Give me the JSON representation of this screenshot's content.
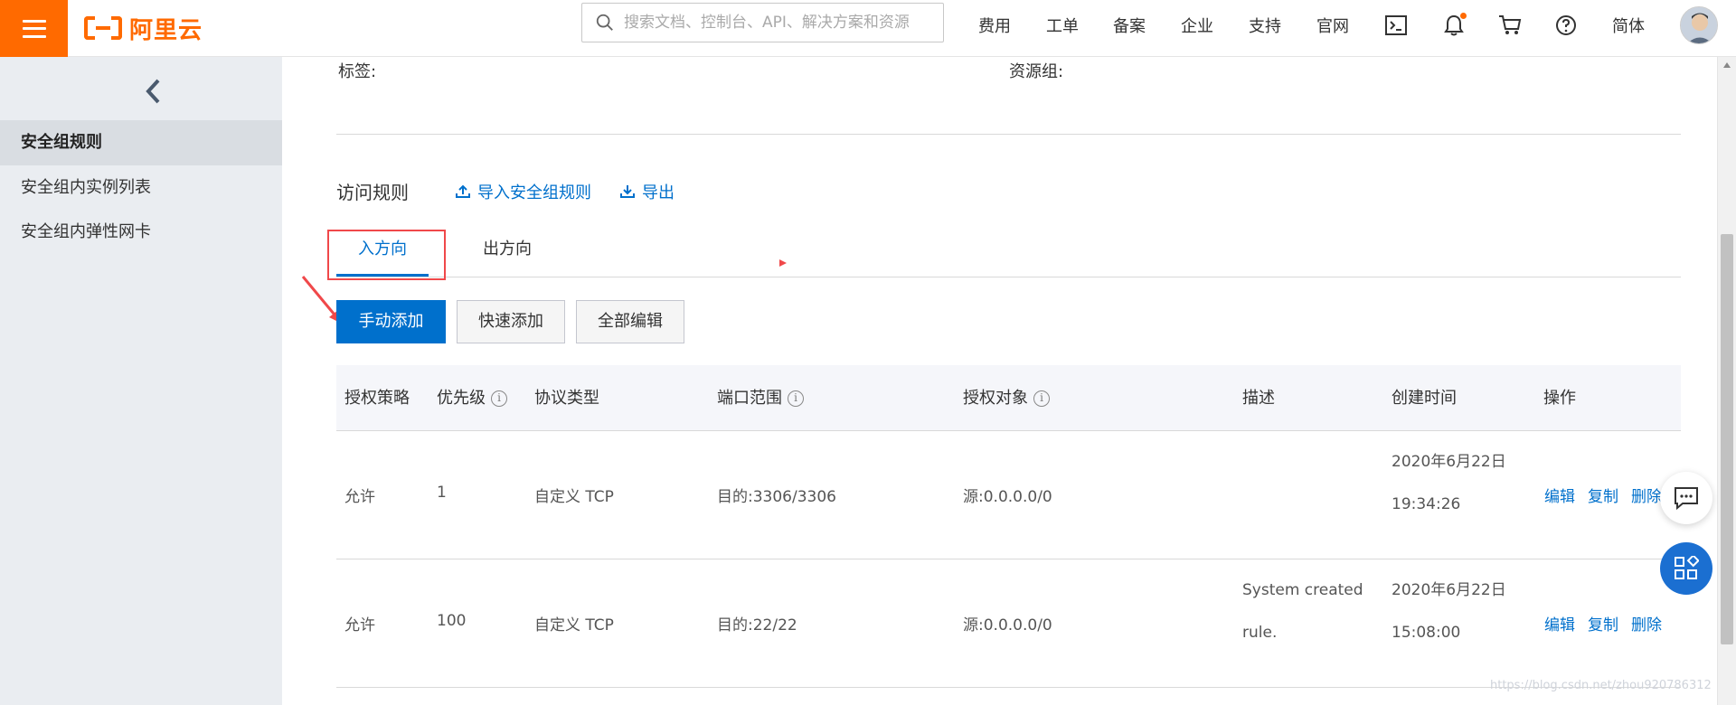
{
  "header": {
    "logo_text": "阿里云",
    "search_placeholder": "搜索文档、控制台、API、解决方案和资源",
    "nav": [
      "费用",
      "工单",
      "备案",
      "企业",
      "支持",
      "官网"
    ],
    "lang": "简体",
    "icons": [
      "terminal-icon",
      "bell-icon",
      "cart-icon",
      "help-icon"
    ]
  },
  "sidebar": {
    "items": [
      {
        "label": "安全组规则",
        "active": true
      },
      {
        "label": "安全组内实例列表",
        "active": false
      },
      {
        "label": "安全组内弹性网卡",
        "active": false
      }
    ]
  },
  "main": {
    "tags_label": "标签:",
    "resource_group_label": "资源组:",
    "section_title": "访问规则",
    "import_label": "导入安全组规则",
    "export_label": "导出",
    "tabs": [
      {
        "label": "入方向",
        "active": true
      },
      {
        "label": "出方向",
        "active": false
      }
    ],
    "buttons": {
      "manual_add": "手动添加",
      "quick_add": "快速添加",
      "edit_all": "全部编辑"
    },
    "table": {
      "headers": [
        "授权策略",
        "优先级",
        "协议类型",
        "端口范围",
        "授权对象",
        "描述",
        "创建时间",
        "操作"
      ],
      "rows": [
        {
          "policy": "允许",
          "priority": "1",
          "protocol": "自定义 TCP",
          "port": "目的:3306/3306",
          "source": "源:0.0.0.0/0",
          "desc_line1": "",
          "desc_line2": "",
          "date": "2020年6月22日",
          "time": "19:34:26",
          "ops": [
            "编辑",
            "复制",
            "删除"
          ]
        },
        {
          "policy": "允许",
          "priority": "100",
          "protocol": "自定义 TCP",
          "port": "目的:22/22",
          "source": "源:0.0.0.0/0",
          "desc_line1": "System created",
          "desc_line2": "rule.",
          "date": "2020年6月22日",
          "time": "15:08:00",
          "ops": [
            "编辑",
            "复制",
            "删除"
          ]
        }
      ]
    }
  },
  "watermark": "https://blog.csdn.net/zhou920786312"
}
